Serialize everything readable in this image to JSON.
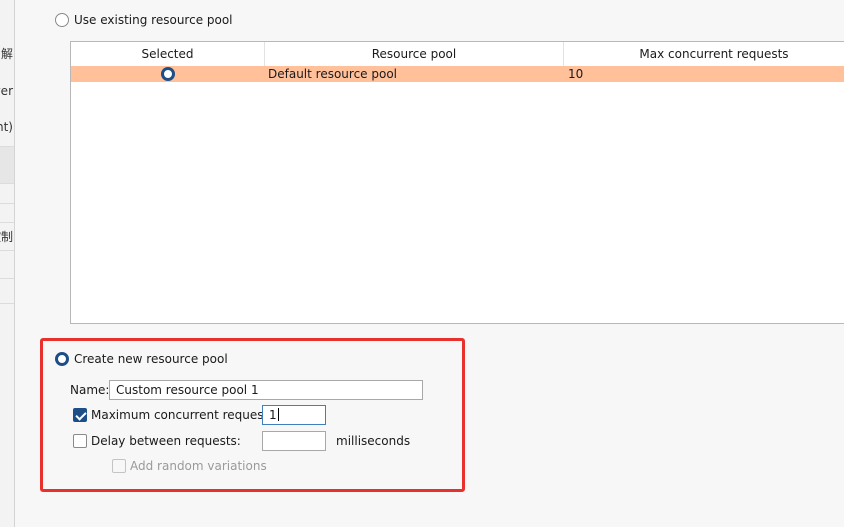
{
  "left_panel": {
    "fragments": [
      "解",
      "ver",
      "nt)",
      "控制"
    ]
  },
  "existing_pool": {
    "radio_label": "Use existing resource pool",
    "selected": false,
    "table": {
      "columns": [
        "Selected",
        "Resource pool",
        "Max concurrent requests"
      ],
      "rows": [
        {
          "selected": true,
          "resource_pool": "Default resource pool",
          "max_concurrent_requests": "10"
        }
      ]
    }
  },
  "new_pool": {
    "radio_label": "Create new resource pool",
    "selected": true,
    "name_label": "Name:",
    "name_value": "Custom resource pool 1",
    "max_concurrent": {
      "label": "Maximum concurrent requests:",
      "checked": true,
      "value": "1"
    },
    "delay": {
      "label": "Delay between requests:",
      "checked": false,
      "value": "",
      "unit": "milliseconds"
    },
    "random_variations": {
      "label": "Add random variations",
      "checked": false,
      "enabled": false
    }
  },
  "colors": {
    "selected_row": "#ffc09a",
    "highlight_border": "#e8302d",
    "accent": "#1d4f86"
  }
}
